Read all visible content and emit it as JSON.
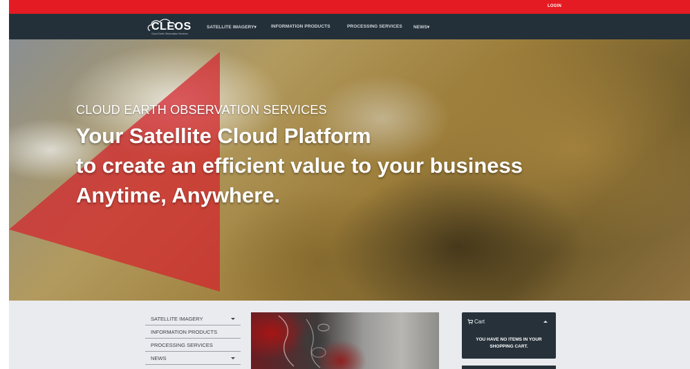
{
  "topbar": {
    "login_label": "LOGIN"
  },
  "navbar": {
    "logo_text": "CLEOS",
    "logo_sub": "Cloud Earth Observation Services",
    "items": [
      {
        "label": "SATELLITE IMAGERY▾"
      },
      {
        "label": "INFORMATION PRODUCTS"
      },
      {
        "label": "PROCESSING SERVICES"
      },
      {
        "label": "NEWS▾"
      }
    ]
  },
  "hero": {
    "subtitle": "CLOUD EARTH OBSERVATION SERVICES",
    "line1": "Your Satellite Cloud Platform",
    "line2": "to create an efficient value to your business",
    "line3": "Anytime, Anywhere."
  },
  "sidebar": {
    "items": [
      {
        "label": "SATELLITE IMAGERY",
        "has_dropdown": true
      },
      {
        "label": "INFORMATION PRODUCTS",
        "has_dropdown": false
      },
      {
        "label": "PROCESSING SERVICES",
        "has_dropdown": false
      },
      {
        "label": "NEWS",
        "has_dropdown": true
      }
    ]
  },
  "cart": {
    "title": "Cart",
    "empty_message": "YOU HAVE NO ITEMS IN YOUR SHOPPING CART."
  },
  "colors": {
    "topbar": "#e51b24",
    "navbar": "#243039",
    "cart_panel": "#263139",
    "hero_triangle": "#d4222c",
    "lower_background": "#eaebef"
  }
}
